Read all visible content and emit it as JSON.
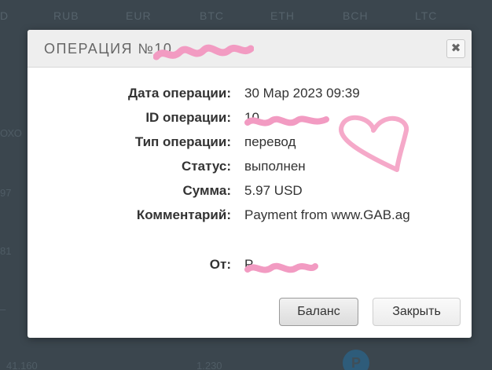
{
  "background": {
    "currency_tabs": [
      "D",
      "RUB",
      "EUR",
      "BTC",
      "ETH",
      "BCH",
      "LTC"
    ],
    "side_fragments": [
      "ОХО",
      "97",
      "81",
      "–"
    ],
    "bottom_fragments": [
      "41.160",
      "1.230"
    ],
    "coin_badge": "P"
  },
  "modal": {
    "title_prefix": "ОПЕРАЦИЯ №",
    "title_number_partial": "10",
    "close_symbol": "✖",
    "details": {
      "date_label": "Дата операции:",
      "date_value": "30 Мар 2023 09:39",
      "id_label": "ID операции:",
      "id_value": "10",
      "type_label": "Тип операции:",
      "type_value": "перевод",
      "status_label": "Статус:",
      "status_value": "выполнен",
      "amount_label": "Сумма:",
      "amount_value": "5.97 USD",
      "comment_label": "Комментарий:",
      "comment_value": "Payment from www.GAB.ag",
      "from_label": "От:",
      "from_value": "P"
    },
    "buttons": {
      "balance": "Баланс",
      "close": "Закрыть"
    }
  },
  "colors": {
    "backdrop": "#3b464e",
    "redaction_pink": "#f29bc2",
    "heart_pink": "#f5a9c9"
  }
}
